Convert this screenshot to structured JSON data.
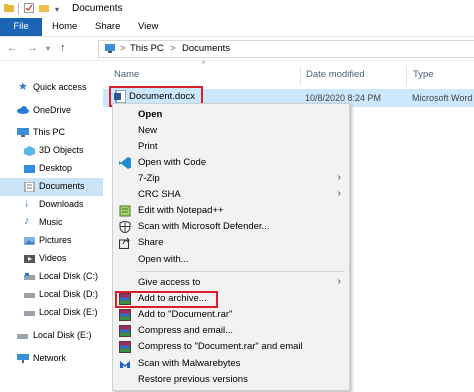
{
  "window": {
    "title": "Documents"
  },
  "ribbon": {
    "tabs": [
      "File",
      "Home",
      "Share",
      "View"
    ]
  },
  "address": {
    "crumbs": [
      "This PC",
      "Documents"
    ],
    "separator": ">"
  },
  "sidebar": {
    "items": [
      {
        "label": "Quick access",
        "icon": "star-icon"
      },
      {
        "label": "OneDrive",
        "icon": "cloud-icon"
      },
      {
        "label": "This PC",
        "icon": "computer-icon"
      },
      {
        "label": "3D Objects",
        "icon": "cube-icon"
      },
      {
        "label": "Desktop",
        "icon": "desktop-icon"
      },
      {
        "label": "Documents",
        "icon": "documents-icon"
      },
      {
        "label": "Downloads",
        "icon": "download-icon"
      },
      {
        "label": "Music",
        "icon": "music-icon"
      },
      {
        "label": "Pictures",
        "icon": "pictures-icon"
      },
      {
        "label": "Videos",
        "icon": "videos-icon"
      },
      {
        "label": "Local Disk (C:)",
        "icon": "disk-icon"
      },
      {
        "label": "Local Disk (D:)",
        "icon": "disk-icon"
      },
      {
        "label": "Local Disk (E:)",
        "icon": "disk-icon"
      },
      {
        "label": "Local Disk (E:)",
        "icon": "disk-icon"
      },
      {
        "label": "Network",
        "icon": "network-icon"
      }
    ]
  },
  "columns": {
    "name": "Name",
    "date": "Date modified",
    "type": "Type"
  },
  "file": {
    "name": "Document.docx",
    "date": "10/8/2020 8:24 PM",
    "type": "Microsoft Word"
  },
  "menu": {
    "items": [
      {
        "label": "Open"
      },
      {
        "label": "New"
      },
      {
        "label": "Print"
      },
      {
        "label": "Open with Code",
        "icon": "vscode-icon"
      },
      {
        "label": "7-Zip"
      },
      {
        "label": "CRC SHA"
      },
      {
        "label": "Edit with Notepad++",
        "icon": "notepadpp-icon"
      },
      {
        "label": "Scan with Microsoft Defender...",
        "icon": "defender-icon"
      },
      {
        "label": "Share",
        "icon": "share-icon"
      },
      {
        "label": "Open with..."
      },
      {
        "label": "Give access to"
      },
      {
        "label": "Add to archive...",
        "icon": "winrar-icon"
      },
      {
        "label": "Add to \"Document.rar\"",
        "icon": "winrar-icon"
      },
      {
        "label": "Compress and email...",
        "icon": "winrar-icon"
      },
      {
        "label": "Compress to \"Document.rar\" and email",
        "icon": "winrar-icon"
      },
      {
        "label": "Scan with Malwarebytes",
        "icon": "malwarebytes-icon"
      },
      {
        "label": "Restore previous versions"
      }
    ]
  },
  "colors": {
    "selection": "#cce8ff",
    "highlight_border": "#d9202a",
    "file_tab": "#1a63b5"
  }
}
